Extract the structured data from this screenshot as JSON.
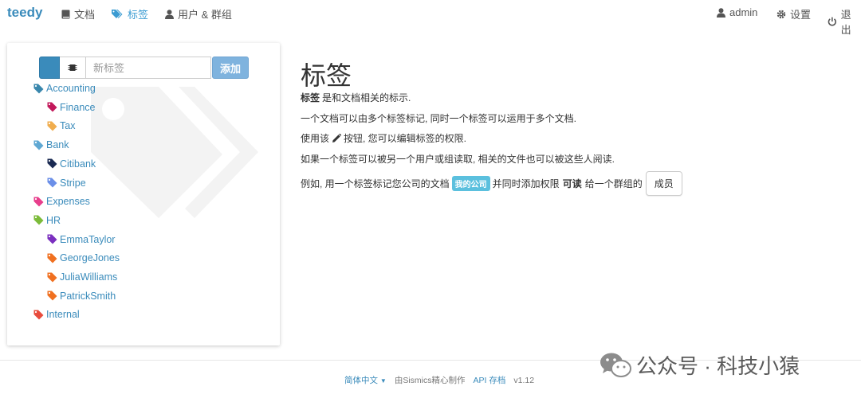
{
  "nav": {
    "brand": "teedy",
    "documents": "文档",
    "tags": "标签",
    "users_groups": "用户 & 群组",
    "username": "admin",
    "settings": "设置",
    "logout": "退出"
  },
  "tag_panel": {
    "new_tag_placeholder": "新标签",
    "add_label": "添加",
    "selected_color": "#3a8bbb",
    "tags": [
      {
        "name": "Accounting",
        "color": "#3a87ad",
        "level": 0
      },
      {
        "name": "Finance",
        "color": "#c2185b",
        "level": 1
      },
      {
        "name": "Tax",
        "color": "#f0ad4e",
        "level": 1
      },
      {
        "name": "Bank",
        "color": "#5fa8d3",
        "level": 0
      },
      {
        "name": "Citibank",
        "color": "#1a2a52",
        "level": 1
      },
      {
        "name": "Stripe",
        "color": "#6b8fe8",
        "level": 1
      },
      {
        "name": "Expenses",
        "color": "#e83e8c",
        "level": 0
      },
      {
        "name": "HR",
        "color": "#7cbb3a",
        "level": 0
      },
      {
        "name": "EmmaTaylor",
        "color": "#7b2fbf",
        "level": 1
      },
      {
        "name": "GeorgeJones",
        "color": "#f07020",
        "level": 1
      },
      {
        "name": "JuliaWilliams",
        "color": "#f07020",
        "level": 1
      },
      {
        "name": "PatrickSmith",
        "color": "#f07020",
        "level": 1
      },
      {
        "name": "Internal",
        "color": "#e84c3d",
        "level": 0
      }
    ]
  },
  "content": {
    "title": "标签",
    "line1_bold": "标签",
    "line1_rest": "是和文档相关的标示.",
    "line2": "一个文档可以由多个标签标记, 同时一个标签可以运用于多个文档.",
    "line3_a": "使用该",
    "line3_b": "按钮, 您可以编辑标签的权限.",
    "line4": "如果一个标签可以被另一个用户或组读取, 相关的文件也可以被这些人阅读.",
    "line5_a": "例如, 用一个标签标记您公司的文档",
    "line5_badge": "我的公司",
    "line5_b": "并同时添加权限",
    "line5_bold": "可读",
    "line5_c": "给一个群组的",
    "member_button": "成员"
  },
  "footer": {
    "language": "简体中文",
    "made_by": "由Sismics精心制作",
    "api_docs": "API 存档",
    "version": "v1.12"
  },
  "wechat_watermark": "公众号 · 科技小猿"
}
